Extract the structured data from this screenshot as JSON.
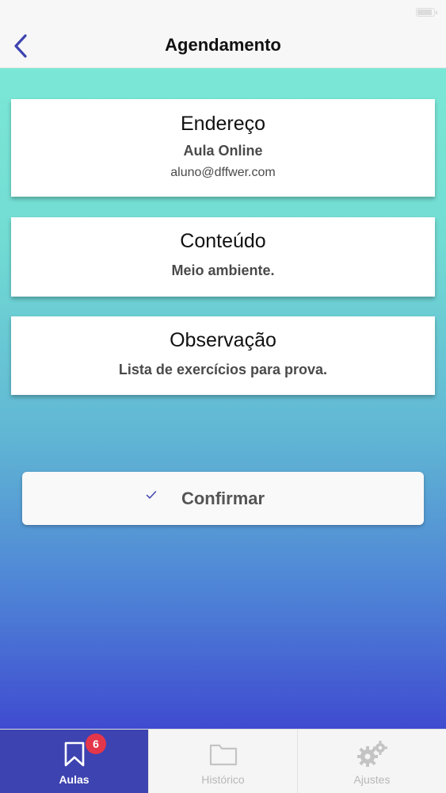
{
  "nav": {
    "title": "Agendamento"
  },
  "cards": [
    {
      "title": "Endereço",
      "line1": "Aula Online",
      "line2": "aluno@dffwer.com"
    },
    {
      "title": "Conteúdo",
      "line1": "Meio ambiente."
    },
    {
      "title": "Observação",
      "line1": "Lista de exercícios para prova."
    }
  ],
  "confirm": {
    "label": "Confirmar",
    "icon": "check-icon"
  },
  "tabs": [
    {
      "label": "Aulas",
      "icon": "bookmark-icon",
      "badge": "6",
      "active": true
    },
    {
      "label": "Histórico",
      "icon": "folder-icon",
      "active": false
    },
    {
      "label": "Ajustes",
      "icon": "gears-icon",
      "active": false
    }
  ],
  "colors": {
    "accent": "#3d43b0",
    "badge": "#e4364a",
    "gradient_top": "#7eecd7",
    "gradient_bottom": "#3f4bd0"
  }
}
